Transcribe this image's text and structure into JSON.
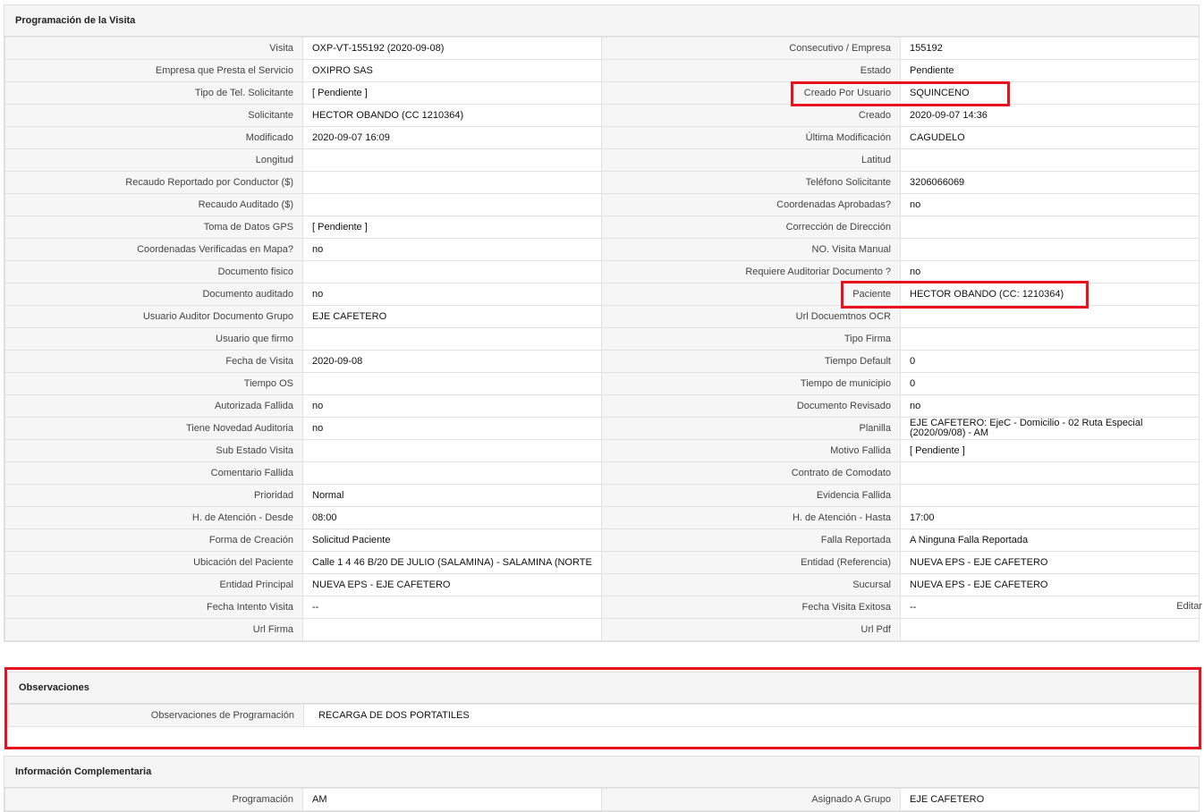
{
  "programacion": {
    "title": "Programación de la Visita",
    "rows": [
      {
        "l1": "Visita",
        "v1": "OXP-VT-155192 (2020-09-08)",
        "l2": "Consecutivo / Empresa",
        "v2": "155192"
      },
      {
        "l1": "Empresa que Presta el Servicio",
        "v1": "OXIPRO SAS",
        "l2": "Estado",
        "v2": "Pendiente"
      },
      {
        "l1": "Tipo de Tel. Solicitante",
        "v1": "[ Pendiente ]",
        "l2": "Creado Por Usuario",
        "v2": "SQUINCENO"
      },
      {
        "l1": "Solicitante",
        "v1": "HECTOR OBANDO (CC 1210364)",
        "l2": "Creado",
        "v2": "2020-09-07 14:36"
      },
      {
        "l1": "Modificado",
        "v1": "2020-09-07 16:09",
        "l2": "Última Modificación",
        "v2": " CAGUDELO"
      },
      {
        "l1": "Longitud",
        "v1": "",
        "l2": "Latitud",
        "v2": ""
      },
      {
        "l1": "Recaudo Reportado por Conductor ($)",
        "v1": "",
        "l2": "Teléfono Solicitante",
        "v2": "3206066069"
      },
      {
        "l1": "Recaudo Auditado ($)",
        "v1": "",
        "l2": "Coordenadas Aprobadas?",
        "v2": " no"
      },
      {
        "l1": "Toma de Datos GPS",
        "v1": "[ Pendiente ]",
        "l2": "Corrección de Dirección",
        "v2": ""
      },
      {
        "l1": "Coordenadas Verificadas en Mapa?",
        "v1": " no",
        "l2": "NO. Visita Manual",
        "v2": ""
      },
      {
        "l1": "Documento fisico",
        "v1": "",
        "l2": "Requiere Auditoriar Documento ?",
        "v2": " no"
      },
      {
        "l1": "Documento auditado",
        "v1": " no",
        "l2": "Paciente",
        "v2": "HECTOR OBANDO (CC: 1210364)"
      },
      {
        "l1": "Usuario Auditor Documento Grupo",
        "v1": "EJE CAFETERO",
        "l2": "Url Docuemtnos OCR",
        "v2": ""
      },
      {
        "l1": "Usuario que firmo",
        "v1": "",
        "l2": "Tipo Firma",
        "v2": ""
      },
      {
        "l1": "Fecha de Visita",
        "v1": " 2020-09-08",
        "l2": "Tiempo Default",
        "v2": "0"
      },
      {
        "l1": "Tiempo OS",
        "v1": "",
        "l2": "Tiempo de municipio",
        "v2": "0"
      },
      {
        "l1": "Autorizada Fallida",
        "v1": " no",
        "l2": "Documento Revisado",
        "v2": " no"
      },
      {
        "l1": "Tiene Novedad Auditoria",
        "v1": " no",
        "l2": "Planilla",
        "v2": "EJE CAFETERO: EjeC - Domicilio - 02 Ruta Especial (2020/09/08) - AM"
      },
      {
        "l1": "Sub Estado Visita",
        "v1": "",
        "l2": "Motivo Fallida",
        "v2": "[ Pendiente ]"
      },
      {
        "l1": "Comentario Fallida",
        "v1": "",
        "l2": "Contrato de Comodato",
        "v2": ""
      },
      {
        "l1": "Prioridad",
        "v1": "Normal",
        "l2": "Evidencia Fallida",
        "v2": ""
      },
      {
        "l1": "H. de Atención - Desde",
        "v1": "08:00",
        "l2": "H. de Atención - Hasta",
        "v2": "17:00"
      },
      {
        "l1": "Forma de Creación",
        "v1": "Solicitud Paciente",
        "l2": "Falla Reportada",
        "v2": "A Ninguna Falla Reportada"
      },
      {
        "l1": "Ubicación del Paciente",
        "v1": "Calle 1 4 46 B/20 DE JULIO (SALAMINA) - SALAMINA (NORTE",
        "l2": "Entidad (Referencia)",
        "v2": "NUEVA EPS - EJE CAFETERO"
      },
      {
        "l1": "Entidad Principal",
        "v1": "NUEVA EPS - EJE CAFETERO",
        "l2": "Sucursal",
        "v2": "NUEVA EPS - EJE CAFETERO"
      },
      {
        "l1": "Fecha Intento Visita",
        "v1": " --",
        "l2": "Fecha Visita Exitosa",
        "v2": " --"
      },
      {
        "l1": "Url Firma",
        "v1": "",
        "l2": "Url Pdf",
        "v2": ""
      }
    ],
    "edit_label": "Editar"
  },
  "observaciones": {
    "title": "Observaciones",
    "label": "Observaciones de Programación",
    "value": "RECARGA DE DOS PORTATILES"
  },
  "complementaria": {
    "title": "Información Complementaria",
    "rows": [
      {
        "l1": "Programación",
        "v1": "AM",
        "l2": "Asignado A Grupo",
        "v2": "EJE CAFETERO"
      }
    ]
  },
  "colors": {
    "highlight": "#e8131f",
    "label_bg": "#f6f6f6",
    "header_bg": "#f5f5f5",
    "border": "#e2e2e2"
  }
}
